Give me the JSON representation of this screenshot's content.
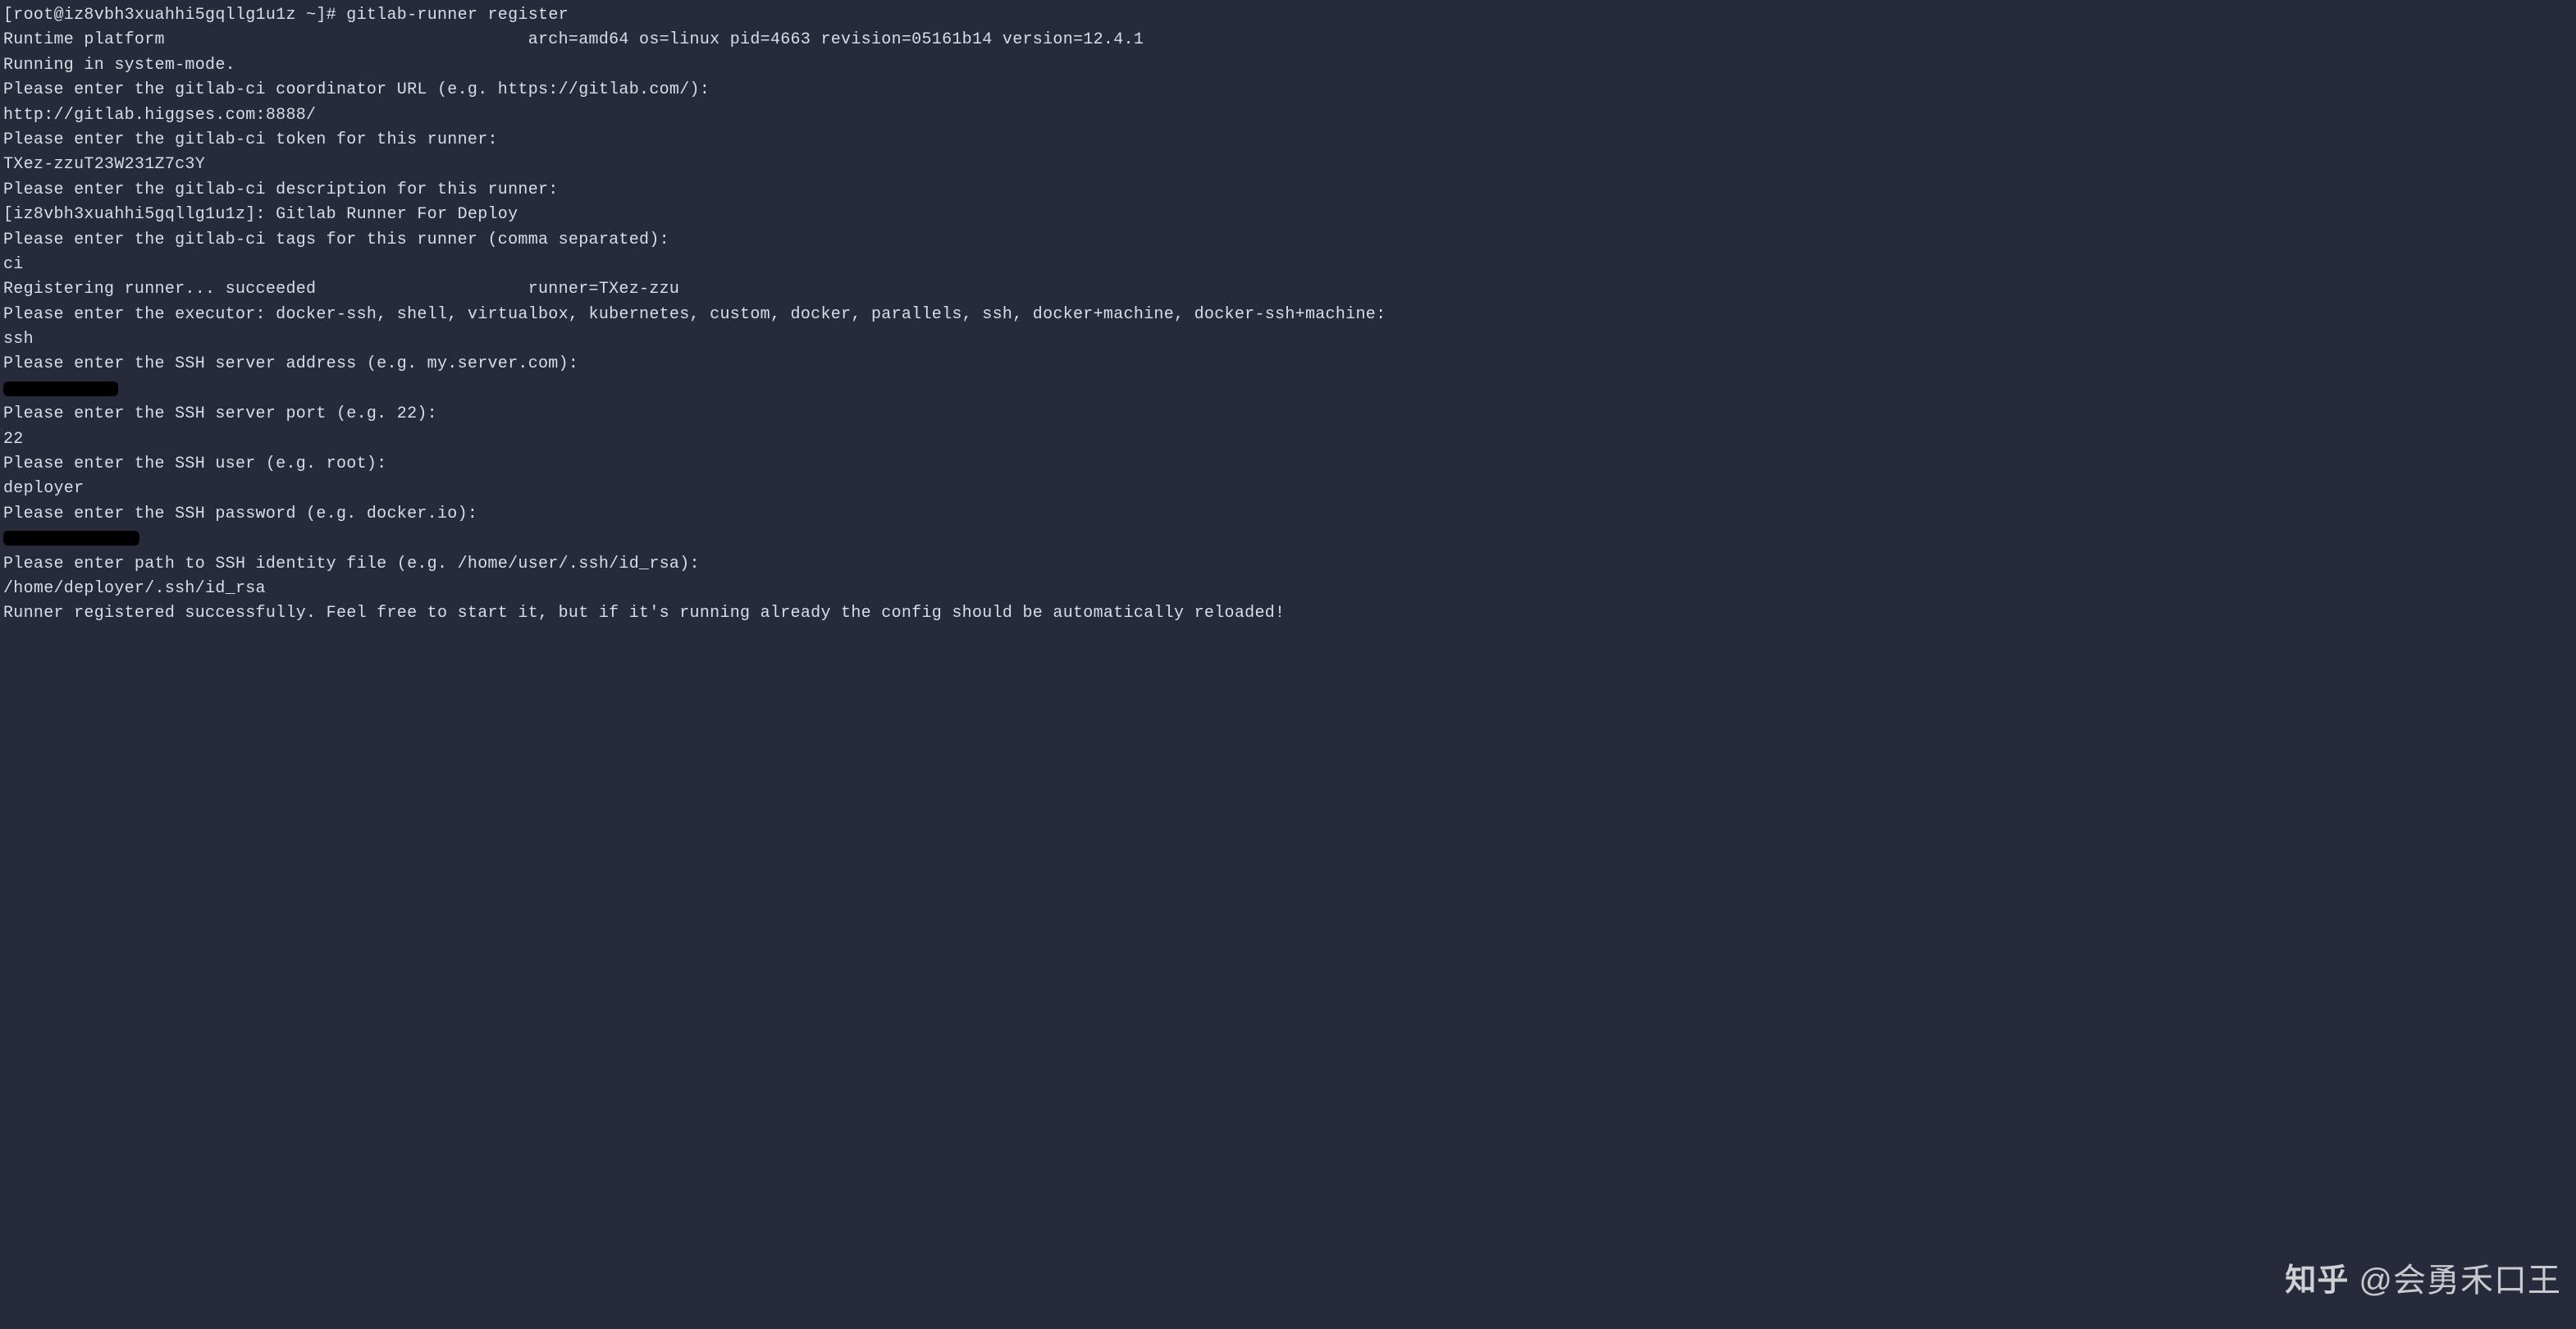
{
  "terminal": {
    "prompt": "[root@iz8vbh3xuahhi5gqllg1u1z ~]# ",
    "command": "gitlab-runner register",
    "lines": [
      "Runtime platform                                    arch=amd64 os=linux pid=4663 revision=05161b14 version=12.4.1",
      "Running in system-mode.",
      "",
      "Please enter the gitlab-ci coordinator URL (e.g. https://gitlab.com/):",
      "http://gitlab.higgses.com:8888/",
      "Please enter the gitlab-ci token for this runner:",
      "TXez-zzuT23W231Z7c3Y",
      "Please enter the gitlab-ci description for this runner:",
      "[iz8vbh3xuahhi5gqllg1u1z]: Gitlab Runner For Deploy",
      "Please enter the gitlab-ci tags for this runner (comma separated):",
      "ci",
      "Registering runner... succeeded                     runner=TXez-zzu",
      "Please enter the executor: docker-ssh, shell, virtualbox, kubernetes, custom, docker, parallels, ssh, docker+machine, docker-ssh+machine:",
      "ssh",
      "Please enter the SSH server address (e.g. my.server.com):"
    ],
    "lines_after_redact1": [
      "Please enter the SSH server port (e.g. 22):",
      "22",
      "Please enter the SSH user (e.g. root):",
      "deployer",
      "Please enter the SSH password (e.g. docker.io):"
    ],
    "lines_after_redact2": [
      "Please enter path to SSH identity file (e.g. /home/user/.ssh/id_rsa):",
      "/home/deployer/.ssh/id_rsa",
      "Runner registered successfully. Feel free to start it, but if it's running already the config should be automatically reloaded!"
    ]
  },
  "watermark": {
    "logo": "知乎",
    "text": "@会勇禾口王"
  }
}
